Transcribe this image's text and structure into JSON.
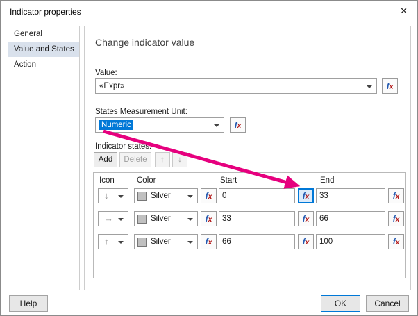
{
  "colors": {
    "annotation": "#e6007e",
    "accent": "#0078d7",
    "silver": "#c0c0c0"
  },
  "icons": {
    "close": "✕",
    "fx_f": "f",
    "fx_x": "x",
    "up": "↑",
    "down": "↓"
  },
  "dialog": {
    "title": "Indicator properties"
  },
  "sidebar": {
    "items": [
      {
        "label": "General",
        "selected": false
      },
      {
        "label": "Value and States",
        "selected": true
      },
      {
        "label": "Action",
        "selected": false
      }
    ]
  },
  "main": {
    "heading": "Change indicator value",
    "value": {
      "label": "Value:",
      "selected": "«Expr»"
    },
    "unit": {
      "label": "States Measurement Unit:",
      "selected": "Numeric"
    },
    "states": {
      "label": "Indicator states:",
      "add": "Add",
      "delete": "Delete",
      "headers": {
        "icon": "Icon",
        "color": "Color",
        "start": "Start",
        "end": "End"
      },
      "rows": [
        {
          "icon_glyph": "↓",
          "icon_name": "arrow-down",
          "color": "Silver",
          "start": "0",
          "end": "33"
        },
        {
          "icon_glyph": "→",
          "icon_name": "arrow-right",
          "color": "Silver",
          "start": "33",
          "end": "66"
        },
        {
          "icon_glyph": "↑",
          "icon_name": "arrow-up",
          "color": "Silver",
          "start": "66",
          "end": "100"
        }
      ]
    }
  },
  "footer": {
    "help": "Help",
    "ok": "OK",
    "cancel": "Cancel"
  }
}
